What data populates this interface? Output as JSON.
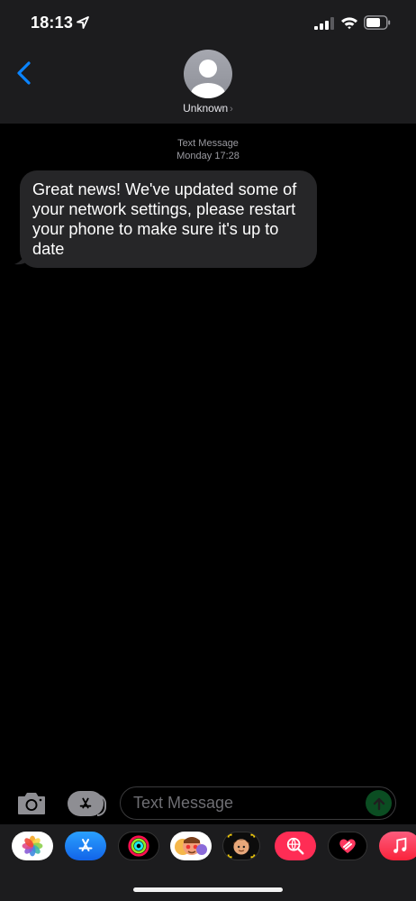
{
  "status_bar": {
    "time": "18:13",
    "icons": [
      "location-arrow-icon",
      "cellular-signal-icon",
      "wifi-icon",
      "battery-icon"
    ]
  },
  "header": {
    "back_icon": "chevron-left-icon",
    "contact_name": "Unknown",
    "contact_chevron": "›"
  },
  "conversation": {
    "meta_type": "Text Message",
    "meta_time": "Monday 17:28",
    "messages": [
      {
        "direction": "incoming",
        "text": "Great news! We've updated some of your network settings, please restart your phone to make sure it's up to date"
      }
    ]
  },
  "composer": {
    "placeholder": "Text Message",
    "camera_icon": "camera-icon",
    "apps_icon": "app-store-icon",
    "send_icon": "send-arrow-icon"
  },
  "app_drawer": {
    "apps": [
      "photos",
      "app-store",
      "activity",
      "memoji-stickers",
      "memoji",
      "images-search",
      "digital-touch",
      "music"
    ]
  },
  "colors": {
    "accent": "#0a84ff",
    "bubble_incoming": "#262628",
    "header_bg": "#1c1c1e",
    "send_disabled": "#0b4d22"
  }
}
